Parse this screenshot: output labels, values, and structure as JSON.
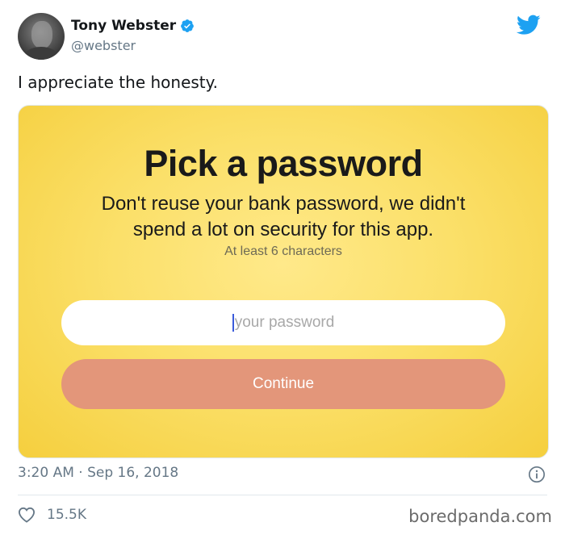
{
  "tweet": {
    "display_name": "Tony Webster",
    "handle": "@webster",
    "text": "I appreciate the honesty.",
    "timestamp": "3:20 AM · Sep 16, 2018",
    "like_count": "15.5K"
  },
  "media": {
    "title": "Pick a password",
    "subtitle_line1": "Don't reuse your bank password, we didn't",
    "subtitle_line2": "spend a lot on security for this app.",
    "hint": "At least 6 characters",
    "password_placeholder": "your password",
    "continue_label": "Continue"
  },
  "watermark": "boredpanda.com",
  "icons": {
    "verified": "verified-badge-icon",
    "brand": "twitter-bird-icon",
    "info": "info-icon",
    "like": "heart-icon"
  },
  "colors": {
    "accent": "#1da1f2",
    "media_background": "#fbe06a",
    "continue_button": "#e3967a",
    "muted_text": "#657786"
  }
}
